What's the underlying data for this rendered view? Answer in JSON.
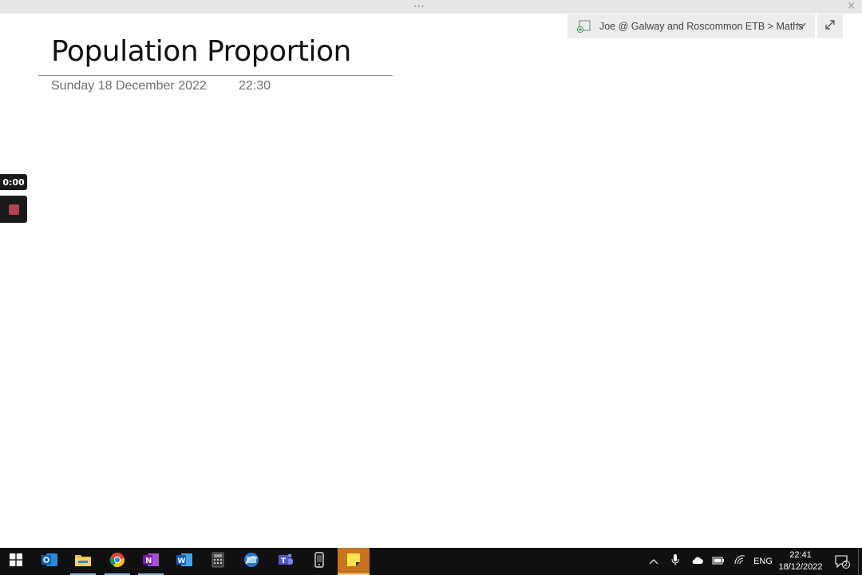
{
  "window": {
    "title_bar_dots": "···",
    "close_glyph": "×"
  },
  "notebook": {
    "breadcrumb": "Joe @ Galway and Roscommon ETB > Maths"
  },
  "page": {
    "title": "Population Proportion",
    "date": "Sunday 18 December 2022",
    "time": "22:30"
  },
  "recorder": {
    "timer": "0:00"
  },
  "taskbar": {
    "apps": [
      {
        "name": "start",
        "icon": "windows-logo-icon"
      },
      {
        "name": "outlook",
        "icon": "outlook-icon"
      },
      {
        "name": "file-explorer",
        "icon": "folder-icon"
      },
      {
        "name": "chrome",
        "icon": "chrome-icon"
      },
      {
        "name": "onenote",
        "icon": "onenote-icon"
      },
      {
        "name": "word",
        "icon": "word-icon"
      },
      {
        "name": "calculator",
        "icon": "calculator-icon"
      },
      {
        "name": "remote-desktop",
        "icon": "remote-desktop-icon"
      },
      {
        "name": "teams",
        "icon": "teams-icon"
      },
      {
        "name": "phone-link",
        "icon": "phone-icon"
      },
      {
        "name": "sticky-notes",
        "icon": "sticky-notes-icon"
      }
    ],
    "language": "ENG",
    "clock_time": "22:41",
    "clock_date": "18/12/2022",
    "notification_count": "2",
    "colors": {
      "background": "#101010",
      "active_app": "#c9731f",
      "running_indicator": "#7fb4e8"
    }
  }
}
